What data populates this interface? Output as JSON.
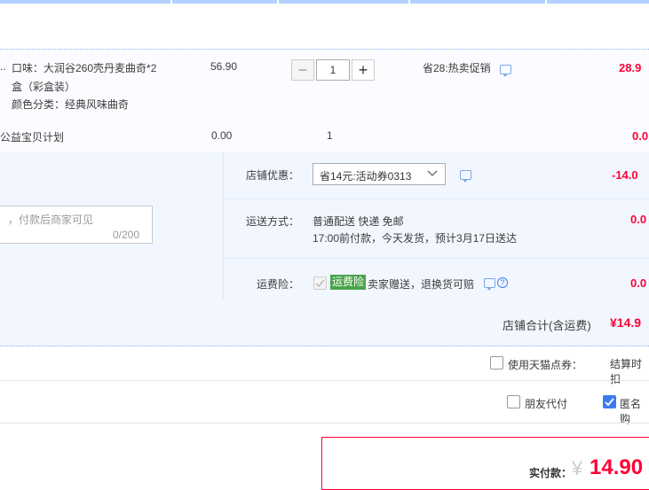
{
  "item": {
    "prefix": "..",
    "attr1": "口味：大润谷260壳丹麦曲奇*2",
    "attr1b": "盒（彩盒装）",
    "attr2": "颜色分类：经典风味曲奇",
    "price": "56.90",
    "quantity": "1",
    "minus": "−",
    "plus": "+",
    "promo": "省28:热卖促销",
    "subtotal": "28.9"
  },
  "charity": {
    "label": "公益宝贝计划",
    "price": "0.00",
    "quantity": "1",
    "subtotal": "0.0"
  },
  "shop_discount": {
    "label": "店铺优惠：",
    "selected": "省14元:活动券0313",
    "amount": "-14.0"
  },
  "delivery": {
    "label": "运送方式：",
    "line1": "普通配送 快递 免邮",
    "line2": "17:00前付款，今天发货，预计3月17日送达",
    "amount": "0.0"
  },
  "insurance": {
    "label": "运费险：",
    "badge": "运费险",
    "text": "卖家赠送，退换货可赔",
    "amount": "0.0"
  },
  "message": {
    "placeholder": "，付款后商家可见",
    "counter": "0/200"
  },
  "shop_total": {
    "label": "店铺合计(含运费)",
    "amount": "¥14.9"
  },
  "points": {
    "label": "使用天猫点券：",
    "note": "结算时扣"
  },
  "friend_pay": {
    "label": "朋友代付"
  },
  "anonymous": {
    "label": "匿名购"
  },
  "payment": {
    "label": "实付款：",
    "currency": "¥",
    "amount": "14.90"
  }
}
